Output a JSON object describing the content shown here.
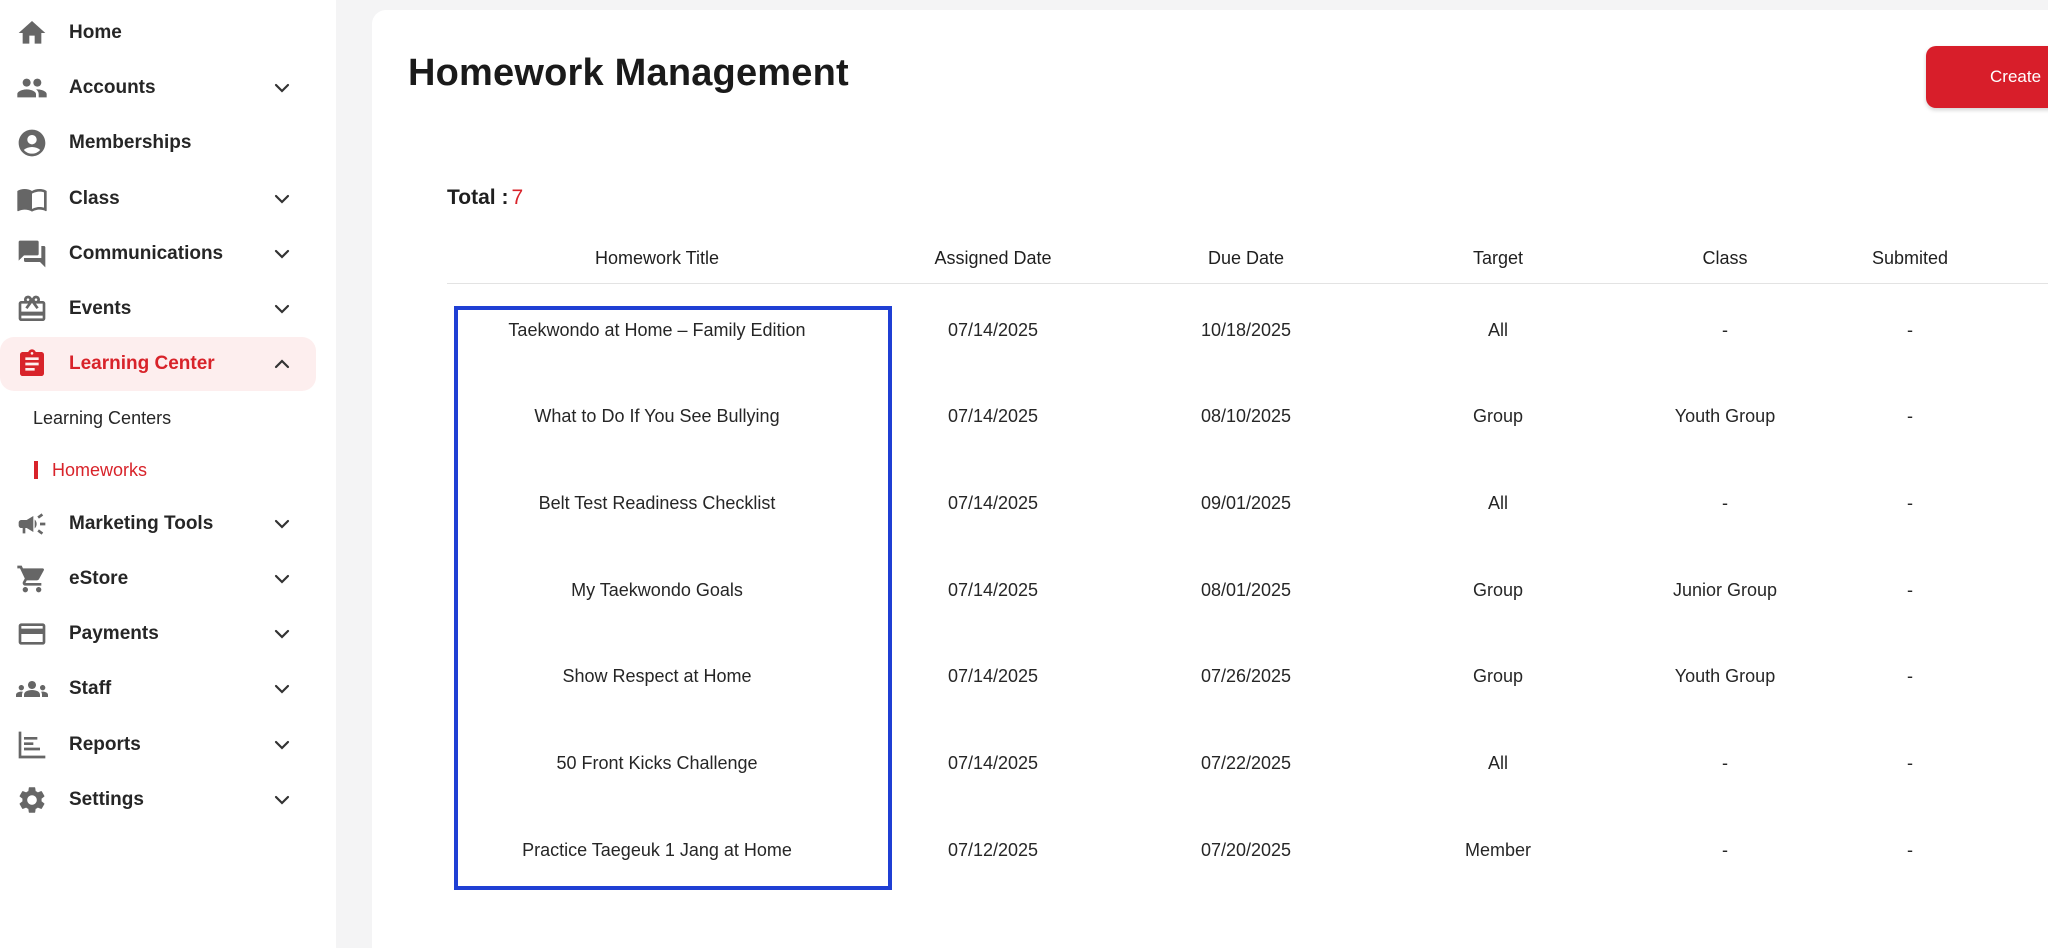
{
  "sidebar": {
    "items": [
      {
        "label": "Home",
        "icon": "home-icon"
      },
      {
        "label": "Accounts",
        "icon": "people-icon"
      },
      {
        "label": "Memberships",
        "icon": "account-circle-icon"
      },
      {
        "label": "Class",
        "icon": "book-icon"
      },
      {
        "label": "Communications",
        "icon": "chat-icon"
      },
      {
        "label": "Events",
        "icon": "gift-icon"
      },
      {
        "label": "Learning Center",
        "icon": "clipboard-icon"
      },
      {
        "label": "Marketing Tools",
        "icon": "megaphone-icon"
      },
      {
        "label": "eStore",
        "icon": "cart-icon"
      },
      {
        "label": "Payments",
        "icon": "credit-card-icon"
      },
      {
        "label": "Staff",
        "icon": "group-icon"
      },
      {
        "label": "Reports",
        "icon": "bar-chart-icon"
      },
      {
        "label": "Settings",
        "icon": "gear-icon"
      }
    ],
    "subitems": [
      {
        "label": "Learning Centers"
      },
      {
        "label": "Homeworks"
      }
    ],
    "active_item": "Learning Center",
    "active_subitem": "Homeworks"
  },
  "main": {
    "title": "Homework Management",
    "create_label": "Create",
    "total_label": "Total :",
    "total_count": "7",
    "columns": [
      "Homework Title",
      "Assigned Date",
      "Due Date",
      "Target",
      "Class",
      "Submited"
    ],
    "rows": [
      [
        "Taekwondo at Home – Family Edition",
        "07/14/2025",
        "10/18/2025",
        "All",
        "-",
        "-"
      ],
      [
        "What to Do If You See Bullying",
        "07/14/2025",
        "08/10/2025",
        "Group",
        "Youth Group",
        "-"
      ],
      [
        "Belt Test Readiness Checklist",
        "07/14/2025",
        "09/01/2025",
        "All",
        "-",
        "-"
      ],
      [
        "My Taekwondo Goals",
        "07/14/2025",
        "08/01/2025",
        "Group",
        "Junior Group",
        "-"
      ],
      [
        "Show Respect at Home",
        "07/14/2025",
        "07/26/2025",
        "Group",
        "Youth Group",
        "-"
      ],
      [
        "50 Front Kicks Challenge",
        "07/14/2025",
        "07/22/2025",
        "All",
        "-",
        "-"
      ],
      [
        "Practice Taegeuk 1 Jang at Home",
        "07/12/2025",
        "07/20/2025",
        "Member",
        "-",
        "-"
      ]
    ]
  },
  "colors": {
    "accent": "#d8232a",
    "active_bg": "#fdeeee",
    "highlight": "#1f3fd4",
    "icon": "#666666"
  }
}
